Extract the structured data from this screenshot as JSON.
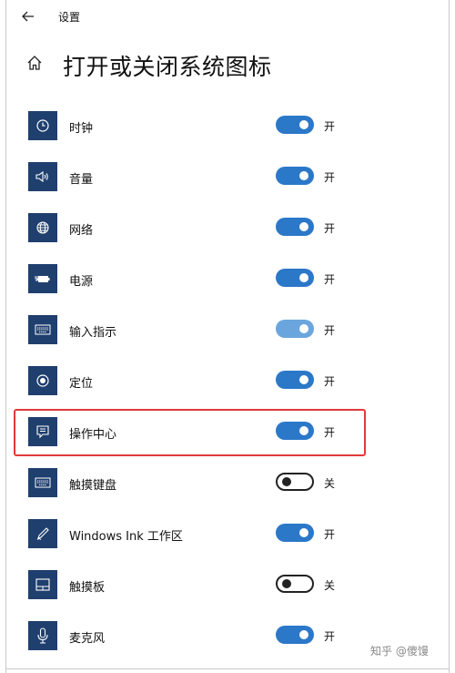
{
  "titlebar": {
    "title": "设置",
    "back_icon": "back-arrow-icon"
  },
  "page": {
    "home_icon": "home-icon",
    "title": "打开或关闭系统图标"
  },
  "items": [
    {
      "label": "时钟",
      "icon": "clock-icon",
      "state": "开",
      "on": true
    },
    {
      "label": "音量",
      "icon": "speaker-icon",
      "state": "开",
      "on": true
    },
    {
      "label": "网络",
      "icon": "globe-icon",
      "state": "开",
      "on": true
    },
    {
      "label": "电源",
      "icon": "battery-plug-icon",
      "state": "开",
      "on": true
    },
    {
      "label": "输入指示",
      "icon": "keyboard-icon",
      "state": "开",
      "on": true,
      "dimmed": true
    },
    {
      "label": "定位",
      "icon": "location-dot-icon",
      "state": "开",
      "on": true
    },
    {
      "label": "操作中心",
      "icon": "action-center-icon",
      "state": "开",
      "on": true,
      "highlighted": true
    },
    {
      "label": "触摸键盘",
      "icon": "touch-keyboard-icon",
      "state": "关",
      "on": false
    },
    {
      "label": "Windows Ink 工作区",
      "icon": "pen-icon",
      "state": "开",
      "on": true
    },
    {
      "label": "触摸板",
      "icon": "touchpad-icon",
      "state": "关",
      "on": false
    },
    {
      "label": "麦克风",
      "icon": "microphone-icon",
      "state": "开",
      "on": true
    }
  ],
  "colors": {
    "icon_tile": "#1f3f6e",
    "toggle_on": "#2b78c9",
    "toggle_on_dimmed": "#6aa6dd",
    "highlight": "#e23a3a"
  },
  "watermark": "知乎 @傻馒"
}
